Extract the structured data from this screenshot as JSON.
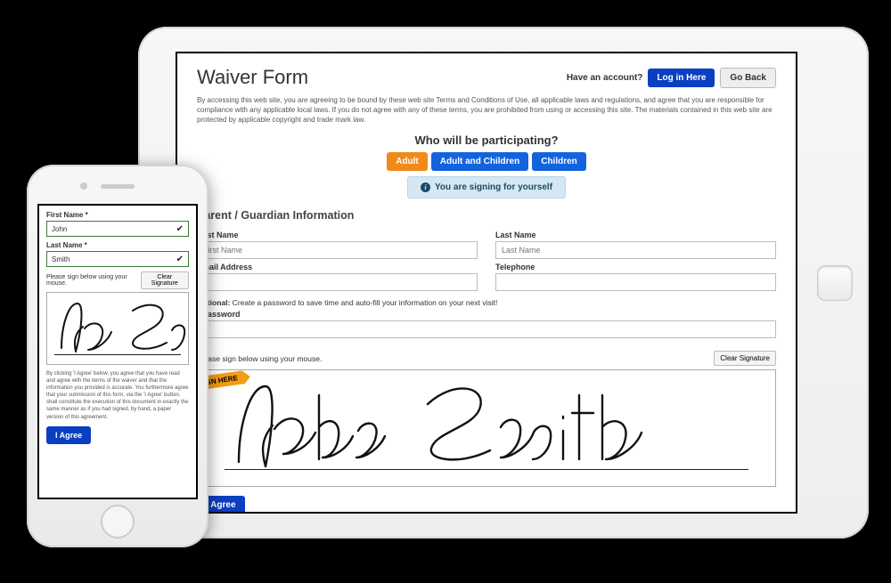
{
  "tablet": {
    "title": "Waiver Form",
    "haveAccount": "Have an account?",
    "loginBtn": "Log in Here",
    "goBackBtn": "Go Back",
    "terms": "By accessing this web site, you are agreeing to be bound by these web site Terms and Conditions of Use, all applicable laws and regulations, and agree that you are responsible for compliance with any applicable local laws. If you do not agree with any of these terms, you are prohibited from using or accessing this site. The materials contained in this web site are protected by applicable copyright and trade mark law.",
    "whoTitle": "Who will be participating?",
    "tabs": {
      "adult": "Adult",
      "adultChildren": "Adult and Children",
      "children": "Children"
    },
    "notice": "You are signing for yourself",
    "sectionTitle": "Parent / Guardian Information",
    "labels": {
      "firstName": "First Name",
      "lastName": "Last Name",
      "email": "Email Address",
      "phone": "Telephone"
    },
    "placeholders": {
      "firstName": "First Name",
      "lastName": "Last Name"
    },
    "optionalBold": "Optional:",
    "optionalText": " Create a password to save time and auto-fill your information on your next visit!",
    "passwordLabel": "Password",
    "signInstruction": "Please sign below using your mouse.",
    "clearBtn": "Clear Signature",
    "signHere": "SIGN HERE",
    "agreeBtn": "I Agree"
  },
  "phone": {
    "firstNameLabel": "First Name *",
    "firstNameValue": "John",
    "lastNameLabel": "Last Name *",
    "lastNameValue": "Smith",
    "signInstruction": "Please sign below using your mouse.",
    "clearBtn": "Clear Signature",
    "legal": "By clicking 'I Agree' below, you agree that you have read and agree with the terms of the waiver and that the information you provided is accurate. You furthermore agree that your submission of this form, via the 'I Agree' button, shall constitute the execution of this document in exactly the same manner as if you had signed, by hand, a paper version of this agreement.",
    "agreeBtn": "I Agree"
  }
}
